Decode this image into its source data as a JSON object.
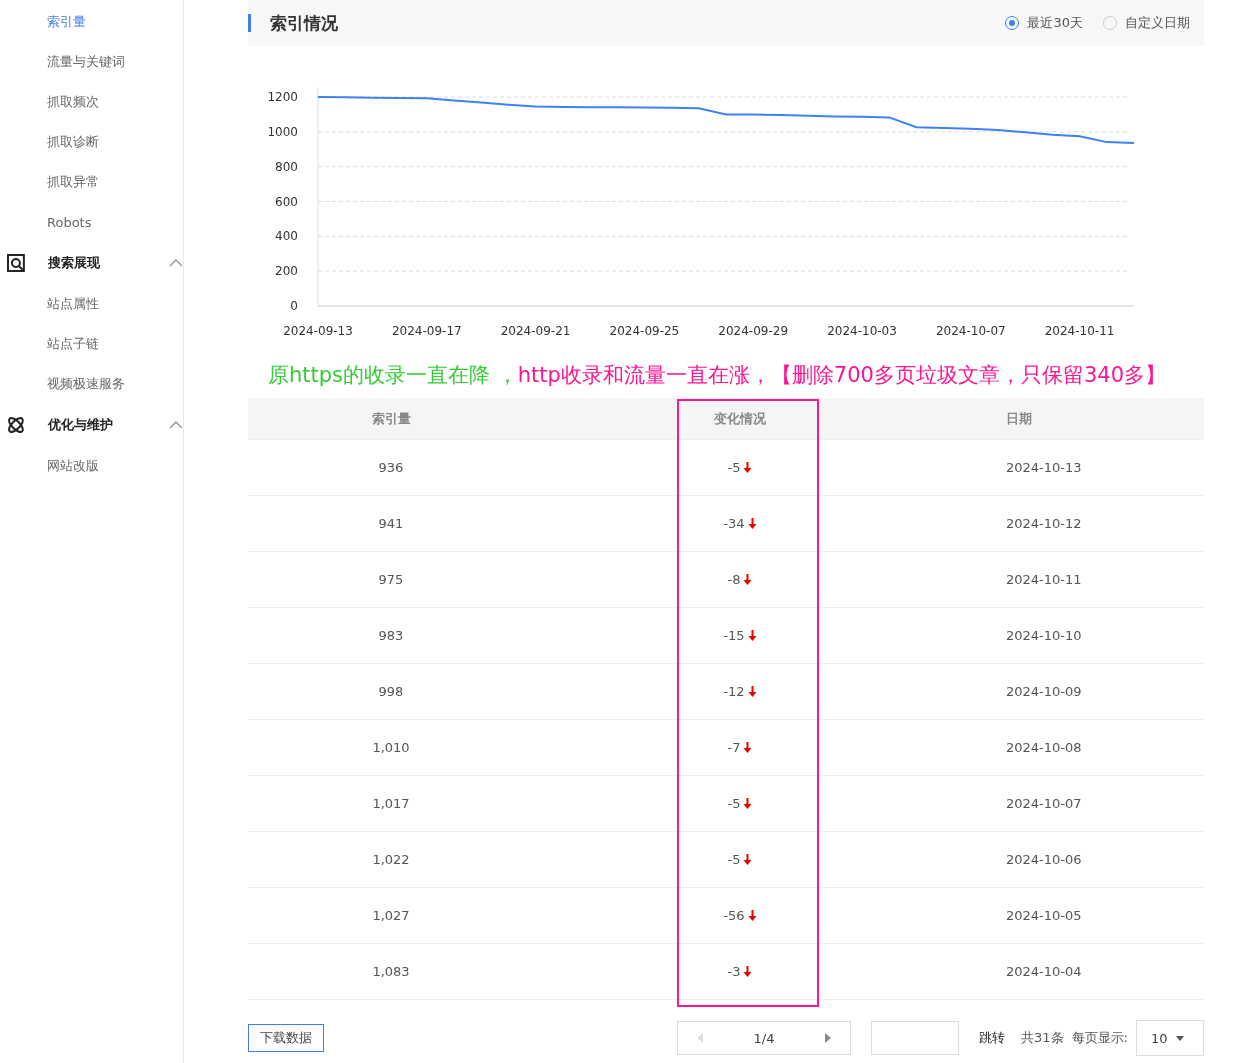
{
  "sidebar": {
    "items": [
      {
        "label": "索引量",
        "selected": true
      },
      {
        "label": "流量与关键词",
        "selected": false
      },
      {
        "label": "抓取频次",
        "selected": false
      },
      {
        "label": "抓取诊断",
        "selected": false
      },
      {
        "label": "抓取异常",
        "selected": false
      },
      {
        "label": "Robots",
        "selected": false
      }
    ],
    "groups": [
      {
        "label": "搜索展现",
        "expanded": true,
        "children": [
          {
            "label": "站点属性",
            "selected": false
          },
          {
            "label": "站点子链",
            "selected": false
          },
          {
            "label": "视频极速服务",
            "selected": false
          }
        ]
      },
      {
        "label": "优化与维护",
        "expanded": true,
        "children": [
          {
            "label": "网站改版",
            "selected": false
          }
        ]
      }
    ]
  },
  "section": {
    "title": "索引情况",
    "range_options": [
      {
        "label": "最近30天",
        "selected": true
      },
      {
        "label": "自定义日期",
        "selected": false
      }
    ]
  },
  "chart_data": {
    "type": "line",
    "categories": [
      "2024-09-13",
      null,
      null,
      null,
      "2024-09-17",
      null,
      null,
      null,
      "2024-09-21",
      null,
      null,
      null,
      "2024-09-25",
      null,
      null,
      null,
      "2024-09-29",
      null,
      null,
      null,
      "2024-10-03",
      null,
      null,
      null,
      "2024-10-07",
      null,
      null,
      null,
      "2024-10-11",
      null,
      null
    ],
    "grid": true,
    "series": [
      {
        "color": "#3b82f6",
        "values": [
          1200,
          1199,
          1195,
          1194,
          1193,
          1180,
          1168,
          1155,
          1145,
          1142,
          1141,
          1141,
          1140,
          1138,
          1135,
          1100,
          1099,
          1097,
          1093,
          1088,
          1086,
          1083,
          1027,
          1022,
          1017,
          1010,
          998,
          983,
          975,
          941,
          936
        ]
      }
    ],
    "ylim": [
      0,
      1200
    ],
    "yticks": [
      0,
      200,
      400,
      600,
      800,
      1000,
      1200
    ]
  },
  "annotation_note": [
    {
      "text": "原https的收录一直在降 ，",
      "color": "#33cc33"
    },
    {
      "text": "http收录和流量一直在涨，【删除700多页垃圾文章，只保留340多】",
      "color": "#ff1493"
    }
  ],
  "table": {
    "columns": [
      {
        "label": "索引量",
        "highlighted": false
      },
      {
        "label": "变化情况",
        "highlighted": true
      },
      {
        "label": "日期",
        "highlighted": false
      }
    ],
    "rows": [
      {
        "count": "936",
        "change": "-5",
        "down": true,
        "date": "2024-10-13"
      },
      {
        "count": "941",
        "change": "-34",
        "down": true,
        "date": "2024-10-12"
      },
      {
        "count": "975",
        "change": "-8",
        "down": true,
        "date": "2024-10-11"
      },
      {
        "count": "983",
        "change": "-15",
        "down": true,
        "date": "2024-10-10"
      },
      {
        "count": "998",
        "change": "-12",
        "down": true,
        "date": "2024-10-09"
      },
      {
        "count": "1,010",
        "change": "-7",
        "down": true,
        "date": "2024-10-08"
      },
      {
        "count": "1,017",
        "change": "-5",
        "down": true,
        "date": "2024-10-07"
      },
      {
        "count": "1,022",
        "change": "-5",
        "down": true,
        "date": "2024-10-06"
      },
      {
        "count": "1,027",
        "change": "-56",
        "down": true,
        "date": "2024-10-05"
      },
      {
        "count": "1,083",
        "change": "-3",
        "down": true,
        "date": "2024-10-04"
      }
    ]
  },
  "download_button": "下载数据",
  "pagination": {
    "prev_disabled": true,
    "next_disabled": false,
    "page": "1/4",
    "jump_label": "跳转",
    "total": "共31条",
    "page_size_label": "每页显示:",
    "page_size": "10"
  }
}
